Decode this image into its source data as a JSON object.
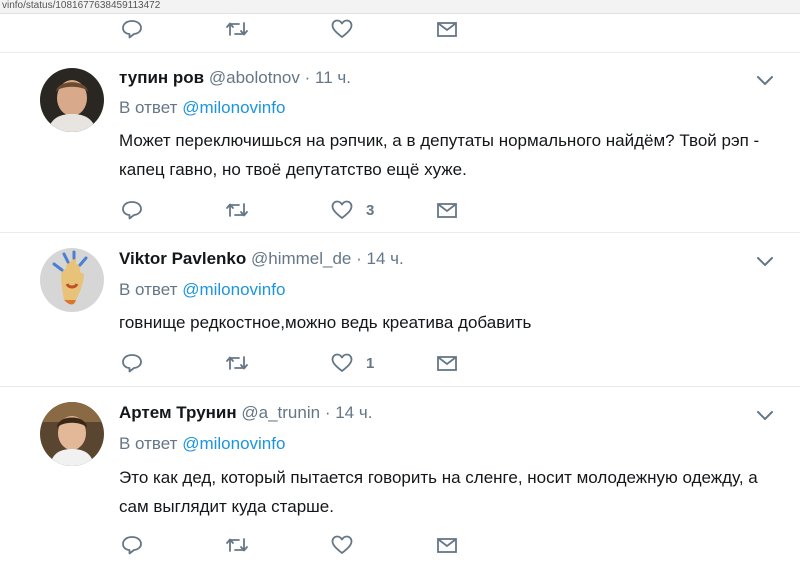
{
  "browser": {
    "url": "vinfo/status/1081677638459113472"
  },
  "tweets": [
    {
      "name": "тупин ров",
      "handle": "@abolotnov",
      "time": "11 ч.",
      "reply_prefix": "В ответ",
      "reply_to": "@milonovinfo",
      "text": "Может переключишься на рэпчик, а в депутаты нормального найдём? Твой рэп - капец гавно, но твоё депутатство ещё хуже.",
      "likes": "3"
    },
    {
      "name": "Viktor Pavlenko",
      "handle": "@himmel_de",
      "time": "14 ч.",
      "reply_prefix": "В ответ",
      "reply_to": "@milonovinfo",
      "text": "говнище  редкостное,можно ведь креатива добавить",
      "likes": "1"
    },
    {
      "name": "Артем Трунин",
      "handle": "@a_trunin",
      "time": "14 ч.",
      "reply_prefix": "В ответ",
      "reply_to": "@milonovinfo",
      "text": "Это как дед, который пытается говорить на сленге, носит молодежную одежду, а сам выглядит куда старше.",
      "likes": ""
    }
  ],
  "icons": {
    "reply": "reply-icon",
    "retweet": "retweet-icon",
    "like": "heart-icon",
    "dm": "envelope-icon",
    "caret": "chevron-down-icon"
  },
  "colors": {
    "link": "#1b95e0",
    "muted": "#657786",
    "icon": "#657786",
    "separator": "#e6ecf0"
  }
}
